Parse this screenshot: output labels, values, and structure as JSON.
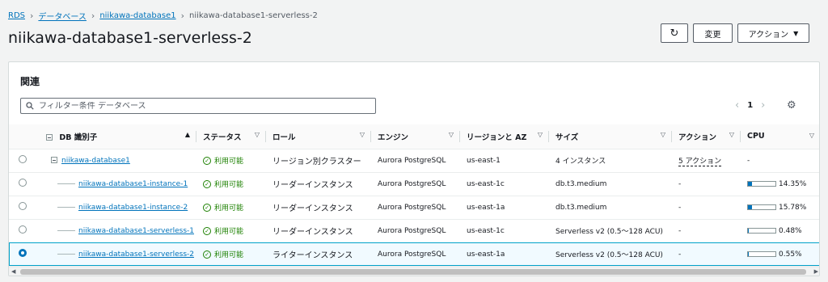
{
  "breadcrumb": {
    "items": [
      "RDS",
      "データベース",
      "niikawa-database1"
    ],
    "current": "niikawa-database1-serverless-2"
  },
  "page": {
    "title": "niikawa-database1-serverless-2"
  },
  "header_buttons": {
    "refresh_icon": "refresh-icon",
    "edit_label": "変更",
    "actions_label": "アクション"
  },
  "panel": {
    "title": "関連",
    "search_placeholder": "フィルター条件 データベース",
    "page_number": "1"
  },
  "table": {
    "columns": [
      "DB 識別子",
      "ステータス",
      "ロール",
      "エンジン",
      "リージョンと AZ",
      "サイズ",
      "アクション",
      "CPU"
    ],
    "rows": [
      {
        "id": "niikawa-database1",
        "status": "利用可能",
        "role": "リージョン別クラスター",
        "engine": "Aurora PostgreSQL",
        "region": "us-east-1",
        "size": "4 インスタンス",
        "action": "5 アクション",
        "cpu": "-",
        "cpu_pct": null,
        "selected": false,
        "level": 0
      },
      {
        "id": "niikawa-database1-instance-1",
        "status": "利用可能",
        "role": "リーダーインスタンス",
        "engine": "Aurora PostgreSQL",
        "region": "us-east-1c",
        "size": "db.t3.medium",
        "action": "-",
        "cpu": "14.35%",
        "cpu_pct": 14.35,
        "selected": false,
        "level": 1
      },
      {
        "id": "niikawa-database1-instance-2",
        "status": "利用可能",
        "role": "リーダーインスタンス",
        "engine": "Aurora PostgreSQL",
        "region": "us-east-1a",
        "size": "db.t3.medium",
        "action": "-",
        "cpu": "15.78%",
        "cpu_pct": 15.78,
        "selected": false,
        "level": 1
      },
      {
        "id": "niikawa-database1-serverless-1",
        "status": "利用可能",
        "role": "リーダーインスタンス",
        "engine": "Aurora PostgreSQL",
        "region": "us-east-1c",
        "size": "Serverless v2 (0.5～128 ACU)",
        "action": "-",
        "cpu": "0.48%",
        "cpu_pct": 0.48,
        "selected": false,
        "level": 1
      },
      {
        "id": "niikawa-database1-serverless-2",
        "status": "利用可能",
        "role": "ライターインスタンス",
        "engine": "Aurora PostgreSQL",
        "region": "us-east-1a",
        "size": "Serverless v2 (0.5～128 ACU)",
        "action": "-",
        "cpu": "0.55%",
        "cpu_pct": 0.55,
        "selected": true,
        "level": 1
      }
    ]
  },
  "colors": {
    "link": "#0073bb",
    "status_ok": "#1d8102",
    "selected_row_bg": "#f1faff"
  }
}
